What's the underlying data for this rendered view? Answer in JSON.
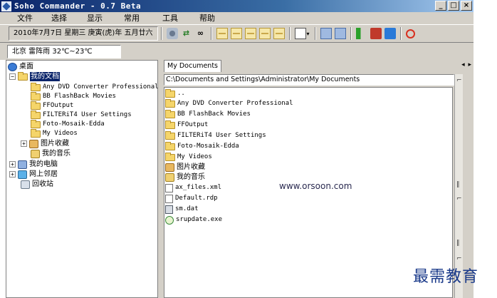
{
  "window": {
    "title": "Soho Commander - 0.7 Beta",
    "controls": [
      "_",
      "□",
      "×"
    ]
  },
  "menu": [
    "文件",
    "选择",
    "显示",
    "常用",
    "工具",
    "帮助"
  ],
  "toolbar": {
    "date": "2010年7月7日 星期三 庚寅(虎)年 五月廿六",
    "icons": [
      "gear-icon",
      "swap-icon",
      "binoculars-icon",
      "layout-1-icon",
      "layout-2-icon",
      "layout-3-icon",
      "layout-4-icon",
      "layout-5-icon",
      "view-icon",
      "db-icon",
      "db2-icon",
      "flag-green-icon",
      "flag-red-icon",
      "flag-blue-icon",
      "power-icon"
    ]
  },
  "weather": "北京  雷阵雨  32℃~23℃",
  "tree": {
    "desktop": "桌面",
    "my_documents": "我的文档",
    "folders": [
      "Any DVD Converter Professional",
      "BB FlashBack Movies",
      "FFOutput",
      "FILTERiT4 User Settings",
      "Foto-Mosaik-Edda",
      "My Videos"
    ],
    "pictures": "图片收藏",
    "music": "我的音乐",
    "my_computer": "我的电脑",
    "network": "网上邻居",
    "recycle_bin": "回收站"
  },
  "right": {
    "tab": "My Documents",
    "tab_arrows": "◂ ▸",
    "path": "C:\\Documents and Settings\\Administrator\\My Documents",
    "parent": "..",
    "folders": [
      "Any DVD Converter Professional",
      "BB FlashBack Movies",
      "FFOutput",
      "FILTERiT4 User Settings",
      "Foto-Mosaik-Edda",
      "My Videos",
      "图片收藏",
      "我的音乐"
    ],
    "files": [
      "ax_files.xml",
      "Default.rdp",
      "sm.dat",
      "srupdate.exe"
    ]
  },
  "watermark": {
    "url": "www.orsoon.com",
    "brand": "最需教育"
  }
}
